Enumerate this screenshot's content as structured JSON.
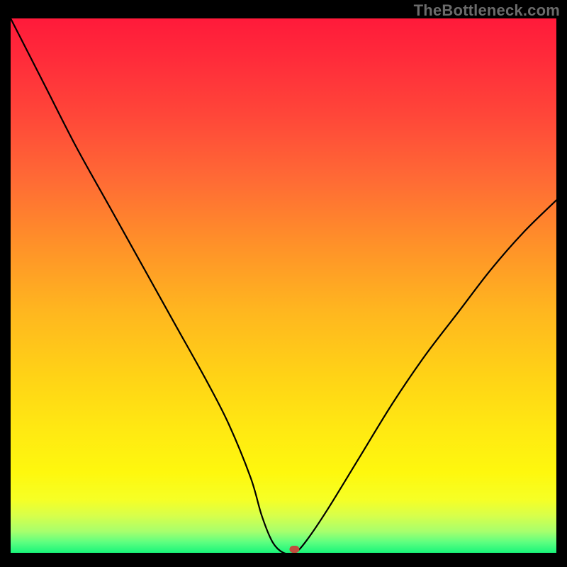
{
  "watermark": "TheBottleneck.com",
  "chart_data": {
    "type": "line",
    "title": "",
    "xlabel": "",
    "ylabel": "",
    "xlim": [
      0,
      100
    ],
    "ylim": [
      0,
      100
    ],
    "series": [
      {
        "name": "curve",
        "x": [
          0,
          6,
          12,
          18,
          24,
          30,
          36,
          40,
          44,
          46,
          48,
          50,
          52,
          54,
          58,
          64,
          70,
          76,
          82,
          88,
          94,
          100
        ],
        "values": [
          100,
          88,
          76,
          65,
          54,
          43,
          32,
          24,
          14,
          7,
          2,
          0,
          0,
          2,
          8,
          18,
          28,
          37,
          45,
          53,
          60,
          66
        ]
      }
    ],
    "marker": {
      "x": 52,
      "y": 0
    },
    "gradient_stops": [
      {
        "pos": 0.0,
        "color": "#ff1a3a"
      },
      {
        "pos": 0.3,
        "color": "#ff6a35"
      },
      {
        "pos": 0.67,
        "color": "#ffd316"
      },
      {
        "pos": 0.9,
        "color": "#f6ff25"
      },
      {
        "pos": 1.0,
        "color": "#19f57a"
      }
    ]
  }
}
